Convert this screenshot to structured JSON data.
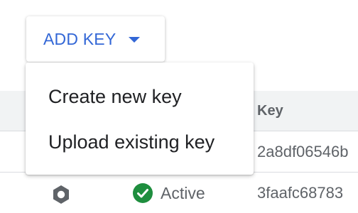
{
  "toolbar": {
    "add_key_label": "ADD KEY",
    "caret_icon": "caret-down-icon"
  },
  "menu": {
    "items": [
      {
        "label": "Create new key"
      },
      {
        "label": "Upload existing key"
      }
    ]
  },
  "table": {
    "header": {
      "key": "Key"
    },
    "rows": [
      {
        "key": "2a8df06546b"
      },
      {
        "key": "3faafc68783",
        "status": "Active",
        "type_icon": "hexagon-key-icon",
        "status_icon": "check-circle-icon"
      }
    ]
  },
  "colors": {
    "accent": "#3367d6",
    "success": "#1e8e3e",
    "text_primary": "#202124",
    "text_secondary": "#5f6368",
    "header_bg": "#f1f3f4",
    "divider": "#dadce0"
  }
}
